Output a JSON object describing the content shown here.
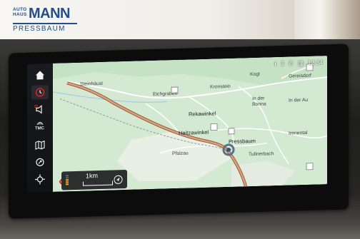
{
  "branding": {
    "logo_prefix": "AUTO HAUS",
    "logo_name": "MANN",
    "logo_location": "PRESSBAUM"
  },
  "colors": {
    "brand_blue": "#1f4f8f",
    "map_green": "#cfe6cf",
    "road_main": "#c98a63",
    "accent_red": "#e2231a"
  },
  "status_bar": {
    "info_count": "3",
    "time": "12:34",
    "icons": [
      "info-icon",
      "phone-icon",
      "signal-icon"
    ]
  },
  "sidebar": {
    "items": [
      {
        "name": "home",
        "icon": "home-icon"
      },
      {
        "name": "recent-destinations",
        "icon": "clock-icon"
      },
      {
        "name": "voice",
        "icon": "speaker-icon"
      },
      {
        "name": "tmc",
        "icon": "traffic-icon",
        "label": "TMC"
      },
      {
        "name": "map-view",
        "icon": "map-icon"
      },
      {
        "name": "route",
        "icon": "route-icon"
      },
      {
        "name": "position",
        "icon": "crosshair-icon"
      }
    ]
  },
  "map": {
    "places": [
      {
        "id": "steinhausl",
        "label": "Steinhäusl"
      },
      {
        "id": "eichgraben",
        "label": "Eichgraben"
      },
      {
        "id": "kronstein",
        "label": "Kronstein"
      },
      {
        "id": "kogl",
        "label": "Kogl"
      },
      {
        "id": "gereisdorf",
        "label": "Gereisdorf"
      },
      {
        "id": "in-der-bonna",
        "label": "In der Bonna"
      },
      {
        "id": "in-der-au",
        "label": "In der Au"
      },
      {
        "id": "rekawinkel",
        "label": "Rekawinkel"
      },
      {
        "id": "haitzawinkel",
        "label": "Haitzawinkel"
      },
      {
        "id": "pressbaum",
        "label": "Pressbaum"
      },
      {
        "id": "irenental",
        "label": "Irenental"
      },
      {
        "id": "pfalzau",
        "label": "Pfalzau"
      },
      {
        "id": "tullnerbach",
        "label": "Tullnerbach"
      }
    ]
  },
  "scale": {
    "distance": "1km",
    "zoom_level_fraction": 0.6
  }
}
